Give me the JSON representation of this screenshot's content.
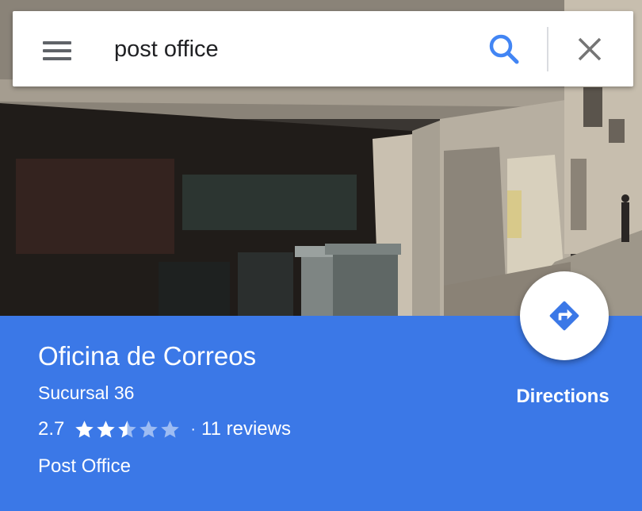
{
  "search": {
    "query": "post office",
    "menu_icon": "hamburger-menu-icon",
    "search_icon": "search-icon",
    "clear_icon": "close-icon",
    "accent": "#4285f4"
  },
  "place": {
    "name": "Oficina de Correos",
    "subtitle": "Sucursal 36",
    "rating": "2.7",
    "rating_value": 2.7,
    "rating_max": 5,
    "separator": "·",
    "reviews": "11 reviews",
    "category": "Post Office",
    "panel_color": "#3b78e7"
  },
  "actions": {
    "directions_label": "Directions",
    "directions_icon": "directions-turn-icon"
  }
}
